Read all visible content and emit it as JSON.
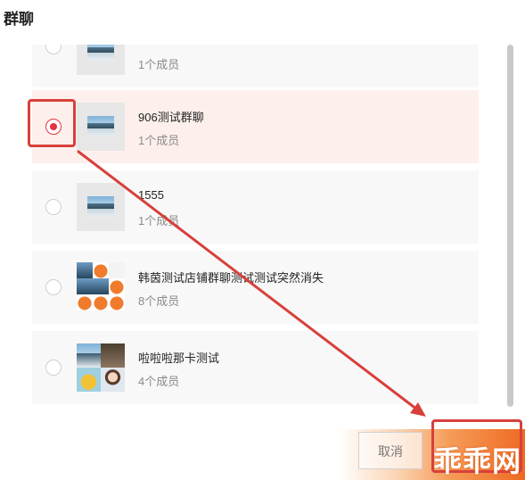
{
  "dialog": {
    "title": "群聊"
  },
  "groups": [
    {
      "name": "",
      "members": "1个成员",
      "selected": false,
      "avatar": "single"
    },
    {
      "name": "906测试群聊",
      "members": "1个成员",
      "selected": true,
      "avatar": "single"
    },
    {
      "name": "1555",
      "members": "1个成员",
      "selected": false,
      "avatar": "single"
    },
    {
      "name": "韩茵测试店铺群聊测试测试突然消失",
      "members": "8个成员",
      "selected": false,
      "avatar": "grid9"
    },
    {
      "name": "啦啦啦那卡测试",
      "members": "4个成员",
      "selected": false,
      "avatar": "grid4"
    }
  ],
  "footer": {
    "cancel_label": "取消",
    "watermark": "乖乖网"
  },
  "colors": {
    "accent": "#e2353f",
    "annotation": "#d8403b",
    "selected_row": "#fdf0ec"
  }
}
